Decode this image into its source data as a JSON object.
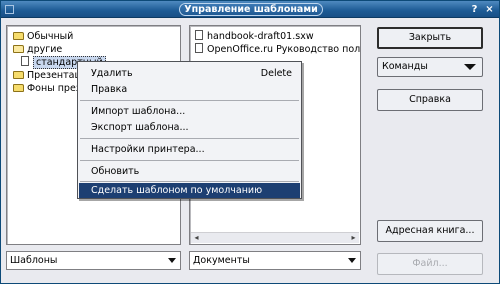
{
  "window": {
    "title": "Управление шаблонами",
    "help_symbol": "?",
    "close_symbol": "×"
  },
  "left_list": {
    "items": [
      {
        "label": "Обычный",
        "icon": "folder-icon"
      },
      {
        "label": "другие",
        "icon": "folder-open-icon"
      },
      {
        "label": "стандартный",
        "icon": "document-icon",
        "selected": true
      },
      {
        "label": "Презентац",
        "icon": "folder-icon"
      },
      {
        "label": "Фоны през",
        "icon": "folder-icon"
      }
    ]
  },
  "right_list": {
    "items": [
      {
        "label": "handbook-draft01.sxw",
        "icon": "document-icon"
      },
      {
        "label": "OpenOffice.ru Руководство пользова",
        "icon": "document-icon"
      }
    ]
  },
  "context_menu": {
    "items": [
      {
        "label": "Удалить",
        "accel": "Delete"
      },
      {
        "label": "Правка"
      },
      {
        "label": "Импорт шаблона..."
      },
      {
        "label": "Экспорт шаблона..."
      },
      {
        "label": "Настройки принтера..."
      },
      {
        "label": "Обновить"
      },
      {
        "label": "Сделать шаблоном по умолчанию",
        "active": true
      }
    ]
  },
  "buttons": {
    "close": "Закрыть",
    "commands": "Команды",
    "help": "Справка",
    "address_book": "Адресная книга...",
    "file": "Файл..."
  },
  "combos": {
    "left_value": "Шаблоны",
    "right_value": "Документы"
  },
  "colors": {
    "titlebar": "#1d5b95",
    "menu_highlight": "#1d3f72"
  }
}
